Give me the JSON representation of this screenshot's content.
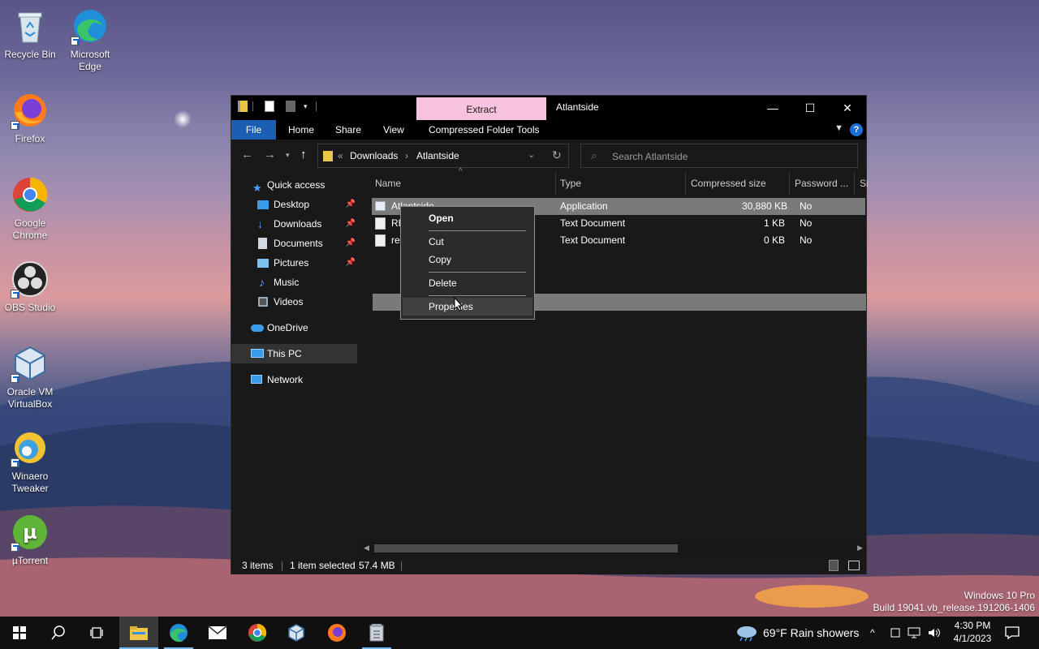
{
  "desktop_icons": [
    {
      "label": "Recycle Bin",
      "icon": "recycle-bin-icon"
    },
    {
      "label": "Microsoft Edge",
      "icon": "edge-icon"
    },
    {
      "label": "Firefox",
      "icon": "firefox-icon"
    },
    {
      "label": "Google Chrome",
      "icon": "chrome-icon"
    },
    {
      "label": "OBS Studio",
      "icon": "obs-icon"
    },
    {
      "label": "Oracle VM VirtualBox",
      "icon": "virtualbox-icon"
    },
    {
      "label": "Winaero Tweaker",
      "icon": "winaero-icon"
    },
    {
      "label": "µTorrent",
      "icon": "utorrent-icon"
    }
  ],
  "window": {
    "title": "Atlantside",
    "contextual_tab": "Extract",
    "ribbon_tabs": [
      "File",
      "Home",
      "Share",
      "View",
      "Compressed Folder Tools"
    ],
    "window_buttons": {
      "minimize": "—",
      "maximize": "☐",
      "close": "✕"
    }
  },
  "address": {
    "overflow": "«",
    "crumbs": [
      "Downloads",
      "Atlantside"
    ],
    "separator": "›"
  },
  "search": {
    "placeholder": "Search Atlantside"
  },
  "nav": {
    "quick_access": "Quick access",
    "items": [
      {
        "label": "Desktop",
        "pinned": true
      },
      {
        "label": "Downloads",
        "pinned": true
      },
      {
        "label": "Documents",
        "pinned": true
      },
      {
        "label": "Pictures",
        "pinned": true
      },
      {
        "label": "Music",
        "pinned": false
      },
      {
        "label": "Videos",
        "pinned": false
      }
    ],
    "onedrive": "OneDrive",
    "this_pc": "This PC",
    "network": "Network"
  },
  "columns": [
    "Name",
    "Type",
    "Compressed size",
    "Password ...",
    "Si"
  ],
  "files": [
    {
      "name": "Atlantside",
      "type": "Application",
      "compressed_size": "30,880 KB",
      "password": "No"
    },
    {
      "name": "README",
      "type": "Text Document",
      "compressed_size": "1 KB",
      "password": "No"
    },
    {
      "name": "readme",
      "type": "Text Document",
      "compressed_size": "0 KB",
      "password": "No"
    }
  ],
  "visible_names": [
    "Atlantside",
    "RE",
    "re"
  ],
  "status": {
    "items": "3 items",
    "selected": "1 item selected",
    "size": "57.4 MB"
  },
  "context_menu": {
    "open": "Open",
    "cut": "Cut",
    "copy": "Copy",
    "delete": "Delete",
    "properties": "Properties"
  },
  "watermark": {
    "line1": "Windows 10 Pro",
    "line2": "Build 19041.vb_release.191206-1406"
  },
  "tray": {
    "weather": "69°F  Rain showers",
    "time": "4:30 PM",
    "date": "4/1/2023"
  },
  "colors": {
    "accent": "#1a5fb4",
    "contextual_tab": "#f7c3dc",
    "selection": "#7a7a7a"
  }
}
